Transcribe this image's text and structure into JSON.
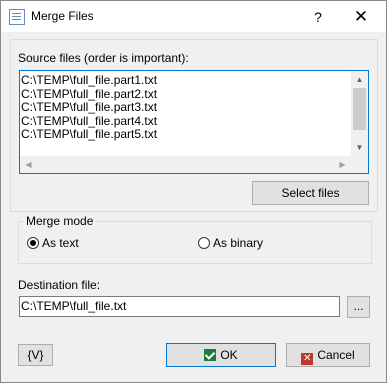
{
  "window": {
    "title": "Merge Files",
    "help_glyph": "?",
    "close_glyph": "✕"
  },
  "source": {
    "label": "Source files (order is important):",
    "files": [
      "C:\\TEMP\\full_file.part1.txt",
      "C:\\TEMP\\full_file.part2.txt",
      "C:\\TEMP\\full_file.part3.txt",
      "C:\\TEMP\\full_file.part4.txt",
      "C:\\TEMP\\full_file.part5.txt"
    ],
    "select_button": "Select files"
  },
  "merge_mode": {
    "label": "Merge mode",
    "as_text": "As text",
    "as_binary": "As binary",
    "selected": "as_text"
  },
  "destination": {
    "label": "Destination file:",
    "value": "C:\\TEMP\\full_file.txt",
    "browse_button": "..."
  },
  "footer": {
    "variables_button": "{V}",
    "ok_button": "OK",
    "cancel_button": "Cancel"
  },
  "icons": {
    "app": "merge-files-icon",
    "ok": "check-icon",
    "cancel": "x-icon"
  }
}
